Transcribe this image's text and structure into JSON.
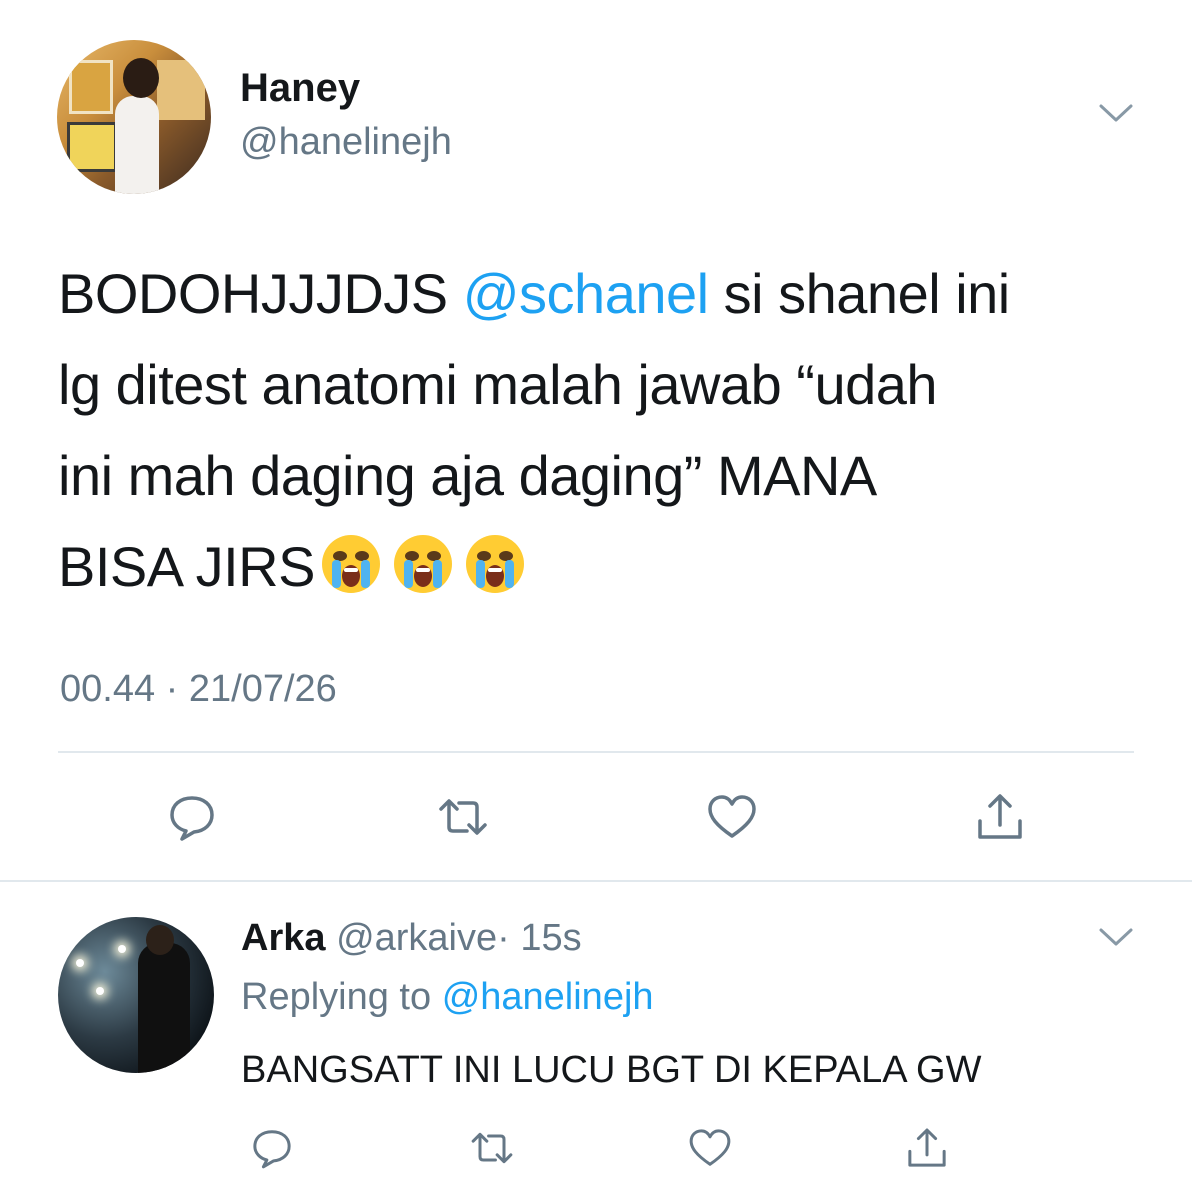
{
  "tweet": {
    "name": "Haney",
    "handle": "@hanelinejh",
    "text_lines": [
      {
        "before": "BODOHJJJDJS ",
        "mention": "@schanel",
        "after": " si shanel ini"
      },
      "lg ditest anatomi malah jawab “udah",
      "ini mah daging aja daging” MANA",
      "BISA JIRS"
    ],
    "emojis": [
      "😭",
      "😭",
      "😭"
    ],
    "timestamp": "00.44 · 21/07/26"
  },
  "reply": {
    "name": "Arka",
    "handle": "@arkaive",
    "time": "· 15s",
    "replying_prefix": "Replying to",
    "replying_to": "@hanelinejh",
    "text": "BANGSATT INI LUCU BGT DI KEPALA GW"
  },
  "colors": {
    "accent": "#1da1f2",
    "muted": "#657786",
    "text": "#14171a",
    "divider": "#e1e8ed"
  },
  "icons": [
    "chevron-down-icon",
    "reply-icon",
    "retweet-icon",
    "like-icon",
    "share-icon"
  ]
}
